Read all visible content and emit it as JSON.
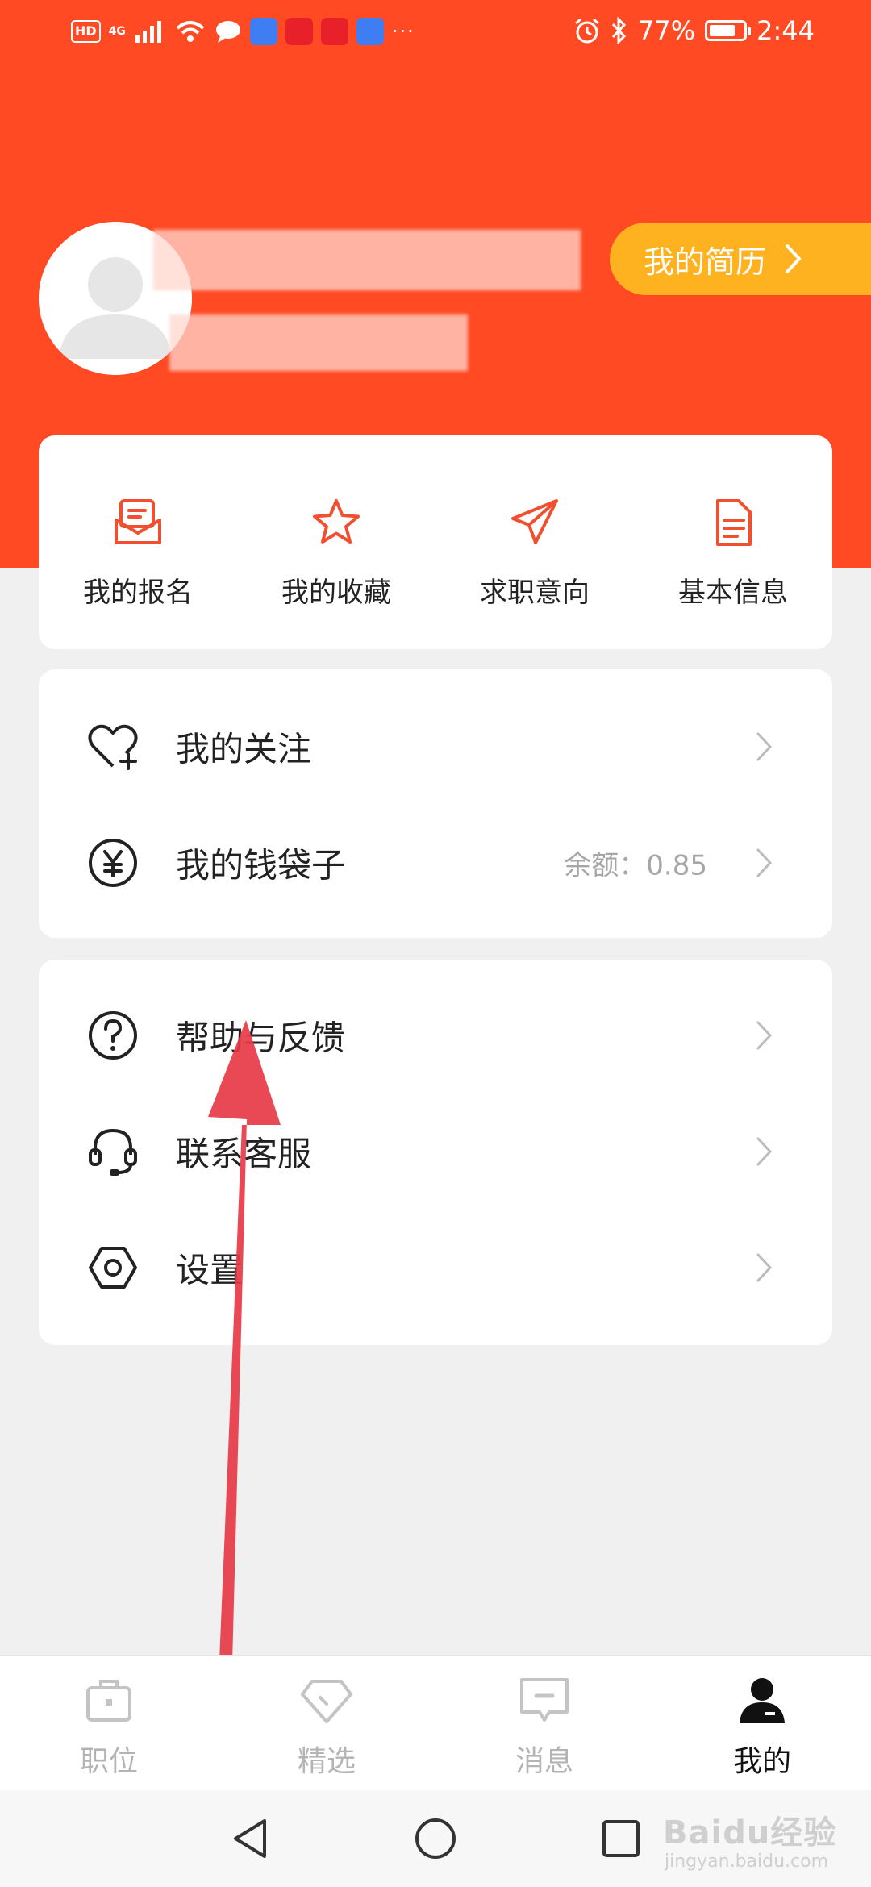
{
  "status_bar": {
    "hd": "HD",
    "network": "4G",
    "more": "···",
    "battery_text": "77%",
    "battery_level": 0.77,
    "time": "2:44"
  },
  "profile": {
    "resume_button": "我的简历"
  },
  "quick_actions": [
    {
      "label": "我的报名",
      "icon": "signup-envelope-icon"
    },
    {
      "label": "我的收藏",
      "icon": "star-icon"
    },
    {
      "label": "求职意向",
      "icon": "paper-plane-icon"
    },
    {
      "label": "基本信息",
      "icon": "document-icon"
    }
  ],
  "list_group_1": [
    {
      "label": "我的关注",
      "icon": "heart-plus-icon"
    },
    {
      "label": "我的钱袋子",
      "icon": "yen-coin-icon",
      "value": "余额：0.85"
    }
  ],
  "list_group_2": [
    {
      "label": "帮助与反馈",
      "icon": "question-icon"
    },
    {
      "label": "联系客服",
      "icon": "headset-icon"
    },
    {
      "label": "设置",
      "icon": "settings-hexagon-icon"
    }
  ],
  "bottom_nav": [
    {
      "label": "职位",
      "icon": "briefcase-icon",
      "active": false
    },
    {
      "label": "精选",
      "icon": "diamond-icon",
      "active": false
    },
    {
      "label": "消息",
      "icon": "message-icon",
      "active": false
    },
    {
      "label": "我的",
      "icon": "user-icon",
      "active": true
    }
  ],
  "watermark": {
    "text": "Baidu经验",
    "sub": "jingyan.baidu.com"
  },
  "colors": {
    "brand": "#ff4a24",
    "resume_button": "#ffb21f",
    "icon_accent": "#f0502f",
    "arrow": "#e63946"
  }
}
